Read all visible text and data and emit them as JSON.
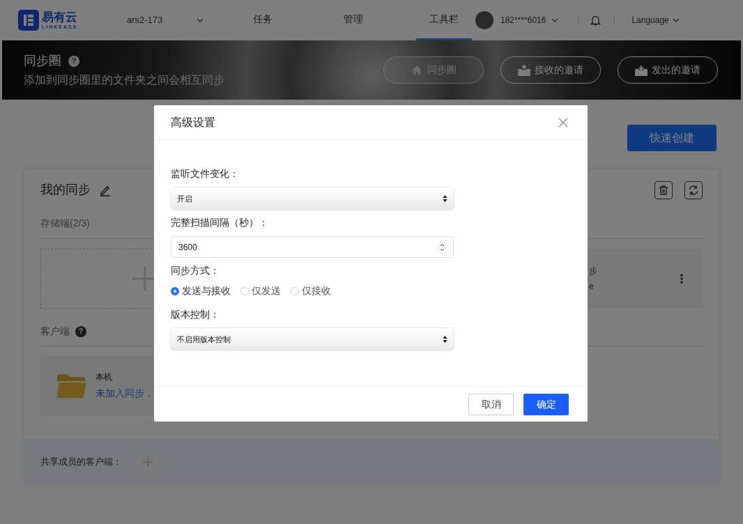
{
  "nav": {
    "logo": {
      "name": "易有云",
      "tagline": "LINKEASE"
    },
    "device": "ars2-173",
    "tabs": [
      {
        "label": "任务",
        "selected": false
      },
      {
        "label": "管理",
        "selected": false
      },
      {
        "label": "工具栏",
        "selected": true
      }
    ],
    "user": "182****6016",
    "language": "Language"
  },
  "banner": {
    "title": "同步圈",
    "help": "?",
    "subtitle": "添加到同步圈里的文件夹之间会相互同步",
    "buttons": [
      {
        "label": "同步圈",
        "kind": "home",
        "selected": true
      },
      {
        "label": "接收的邀请",
        "kind": "inbox",
        "selected": false
      },
      {
        "label": "发出的邀请",
        "kind": "outbox",
        "selected": false
      }
    ]
  },
  "quick_create": "快速创建",
  "my_sync": {
    "title": "我的同步",
    "storage_label": "存储端(2/3)",
    "storage_cards": [
      {
        "kind": "add"
      },
      {
        "kind": "device",
        "name": "步",
        "detail": "e"
      }
    ],
    "client_label": "客户端",
    "client_help": "?",
    "clients": [
      {
        "name": "本机",
        "status": "未加入同步，"
      }
    ],
    "shared_label": "共享成员的客户端："
  },
  "dialog": {
    "title": "高级设置",
    "fields": [
      {
        "kind": "select",
        "label": "监听文件变化：",
        "value": "开启"
      },
      {
        "kind": "number",
        "label": "完整扫描间隔（秒）：",
        "value": "3600"
      },
      {
        "kind": "radio",
        "label": "同步方式：",
        "options": [
          {
            "label": "发送与接收",
            "selected": true
          },
          {
            "label": "仅发送",
            "selected": false
          },
          {
            "label": "仅接收",
            "selected": false
          }
        ]
      },
      {
        "kind": "select",
        "label": "版本控制：",
        "value": "不启用版本控制"
      }
    ],
    "buttons": [
      {
        "label": "取消",
        "kind": "secondary"
      },
      {
        "label": "确定",
        "kind": "primary"
      }
    ]
  }
}
